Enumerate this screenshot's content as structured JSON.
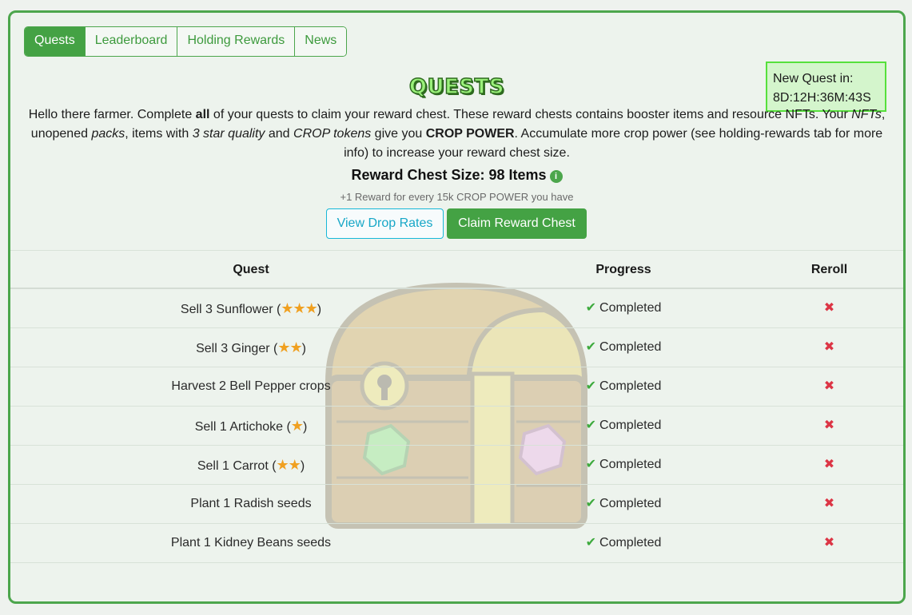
{
  "tabs": [
    {
      "label": "Quests",
      "active": true
    },
    {
      "label": "Leaderboard",
      "active": false
    },
    {
      "label": "Holding Rewards",
      "active": false
    },
    {
      "label": "News",
      "active": false
    }
  ],
  "timer": {
    "label": "New Quest in:",
    "value": "8D:12H:36M:43S"
  },
  "title": "QUESTS",
  "intro": {
    "p1": "Hello there farmer. Complete ",
    "b1": "all",
    "p2": " of your quests to claim your reward chest. These reward chests contains booster items and resource NFTs. Your ",
    "i1": "NFTs",
    "p3": ", unopened ",
    "i2": "packs",
    "p4": ", items with ",
    "i3": "3 star quality",
    "p5": " and ",
    "i4": "CROP tokens",
    "p6": " give you ",
    "b2": "CROP POWER",
    "p7": ". Accumulate more crop power (see holding-rewards tab for more info) to increase your reward chest size."
  },
  "chest_size": {
    "text": "Reward Chest Size: 98 Items",
    "info_icon": "info-icon"
  },
  "subtext": "+1 Reward for every 15k CROP POWER you have",
  "buttons": {
    "drop_rates": "View Drop Rates",
    "claim": "Claim Reward Chest"
  },
  "table": {
    "headers": [
      "Quest",
      "Progress",
      "Reroll"
    ],
    "rows": [
      {
        "pre": "Sell 3 Sunflower (",
        "stars": "★★★",
        "post": ")",
        "progress": "Completed"
      },
      {
        "pre": "Sell 3 Ginger (",
        "stars": "★★",
        "post": ")",
        "progress": "Completed"
      },
      {
        "pre": "Harvest 2 Bell Pepper crops",
        "stars": "",
        "post": "",
        "progress": "Completed"
      },
      {
        "pre": "Sell 1 Artichoke (",
        "stars": "★",
        "post": ")",
        "progress": "Completed"
      },
      {
        "pre": "Sell 1 Carrot (",
        "stars": "★★",
        "post": ")",
        "progress": "Completed"
      },
      {
        "pre": "Plant 1 Radish seeds",
        "stars": "",
        "post": "",
        "progress": "Completed"
      },
      {
        "pre": "Plant 1 Kidney Beans seeds",
        "stars": "",
        "post": "",
        "progress": "Completed"
      }
    ],
    "check_glyph": "✔",
    "reroll_glyph": "✖"
  },
  "colors": {
    "accent": "#44a244",
    "info": "#17a7c7",
    "danger": "#dc3545",
    "timer_bg": "#d4f5cc"
  }
}
